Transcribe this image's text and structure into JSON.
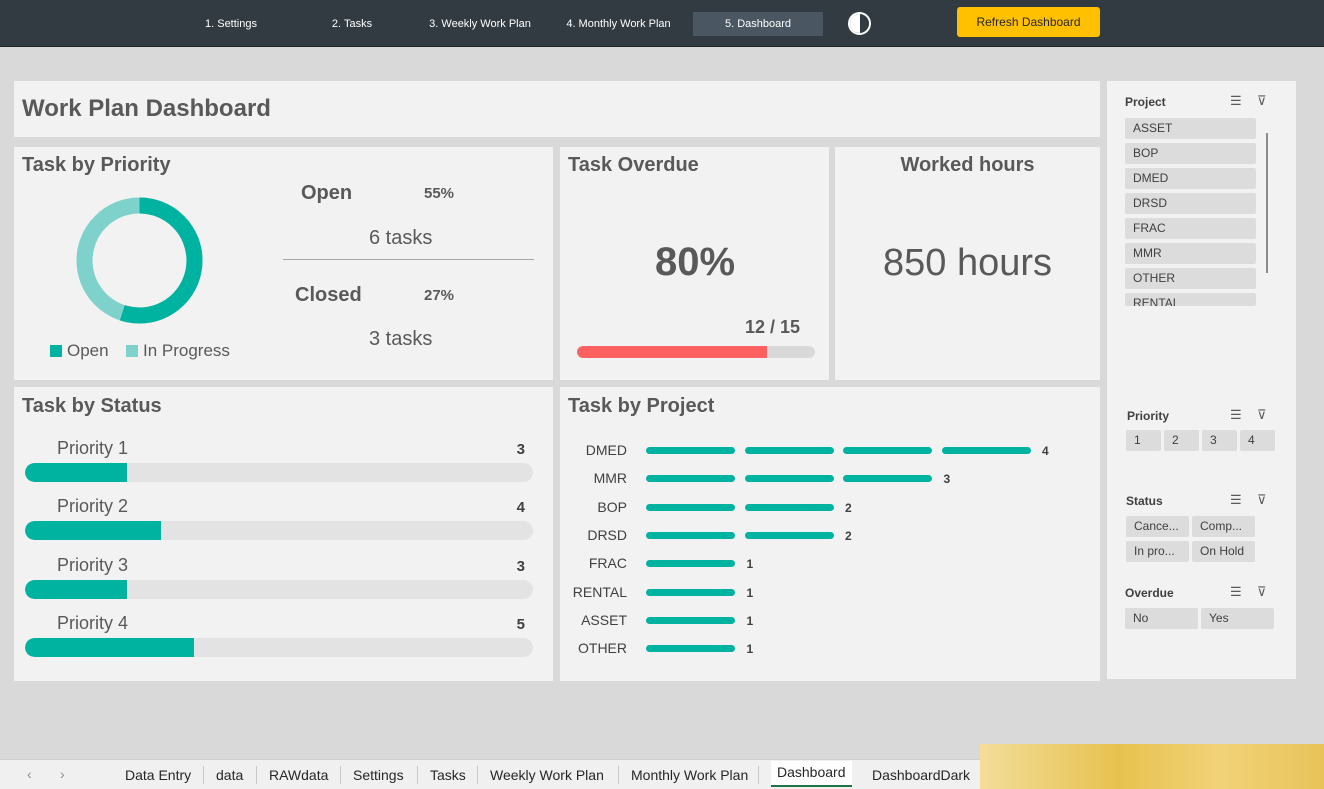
{
  "nav": {
    "items": [
      "1. Settings",
      "2. Tasks",
      "3. Weekly Work Plan",
      "4. Monthly Work Plan",
      "5. Dashboard"
    ],
    "refresh_label": "Refresh Dashboard"
  },
  "title": "Work Plan Dashboard",
  "priority_card": {
    "title": "Task by Priority",
    "legend": [
      "Open",
      "In Progress"
    ],
    "open_label": "Open",
    "open_pct": "55%",
    "open_tasks": "6 tasks",
    "closed_label": "Closed",
    "closed_pct": "27%",
    "closed_tasks": "3 tasks",
    "donut_open_fraction": 0.55
  },
  "overdue_card": {
    "title": "Task Overdue",
    "pct": "80%",
    "ratio": "12 / 15",
    "fraction": 0.8
  },
  "hours_card": {
    "title": "Worked hours",
    "value": "850 hours"
  },
  "status_card": {
    "title": "Task by Status",
    "rows": [
      {
        "label": "Priority 1",
        "value": "3",
        "fraction": 0.2
      },
      {
        "label": "Priority 2",
        "value": "4",
        "fraction": 0.267
      },
      {
        "label": "Priority 3",
        "value": "3",
        "fraction": 0.2
      },
      {
        "label": "Priority 4",
        "value": "5",
        "fraction": 0.333
      }
    ]
  },
  "project_card": {
    "title": "Task by Project"
  },
  "chart_data": {
    "type": "bar",
    "title": "Task by Project",
    "categories": [
      "DMED",
      "MMR",
      "BOP",
      "DRSD",
      "FRAC",
      "RENTAL",
      "ASSET",
      "OTHER"
    ],
    "values": [
      4,
      3,
      2,
      2,
      1,
      1,
      1,
      1
    ],
    "orientation": "horizontal",
    "color": "#00b2a0"
  },
  "slicers": {
    "project": {
      "title": "Project",
      "items": [
        "ASSET",
        "BOP",
        "DMED",
        "DRSD",
        "FRAC",
        "MMR",
        "OTHER",
        "RENTAL"
      ]
    },
    "priority": {
      "title": "Priority",
      "items": [
        "1",
        "2",
        "3",
        "4"
      ]
    },
    "status": {
      "title": "Status",
      "items": [
        "Cance...",
        "Comp...",
        "In pro...",
        "On Hold"
      ]
    },
    "overdue": {
      "title": "Overdue",
      "items": [
        "No",
        "Yes"
      ]
    }
  },
  "sheet_tabs": [
    "Data Entry",
    "data",
    "RAWdata",
    "Settings",
    "Tasks",
    "Weekly Work Plan",
    "Monthly Work Plan",
    "Dashboard",
    "DashboardDark"
  ],
  "colors": {
    "accent": "#00b2a0",
    "accent_light": "#7fd1cc",
    "overdue": "#ff6161",
    "button": "#ffc000"
  },
  "icons": {
    "multi_select": "multi-select-icon",
    "clear_filter": "clear-filter-icon"
  }
}
